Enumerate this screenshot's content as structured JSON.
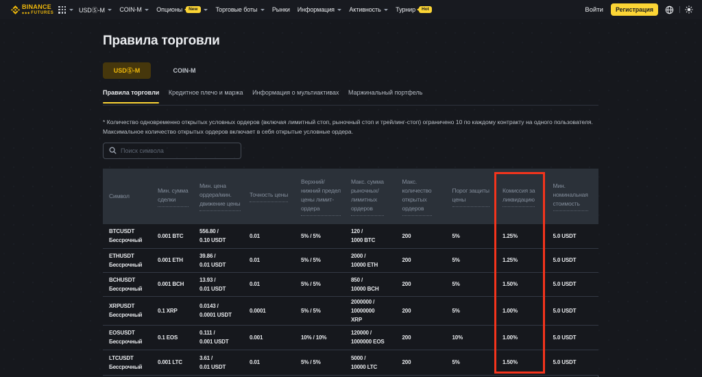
{
  "brand": {
    "name_top": "BINANCE",
    "name_bottom": "FUTURES"
  },
  "topnav": {
    "items": [
      {
        "label": "USDⓈ-M"
      },
      {
        "label": "COIN-M"
      },
      {
        "label": "Опционы",
        "badge": "New"
      },
      {
        "label": "Торговые боты"
      },
      {
        "label": "Рынки"
      },
      {
        "label": "Информация"
      },
      {
        "label": "Активность"
      },
      {
        "label": "Турнир",
        "badge": "Hot"
      }
    ],
    "login_label": "Войти",
    "register_label": "Регистрация"
  },
  "page": {
    "title": "Правила торговли",
    "market_tabs": [
      {
        "label": "USDⓈ-M",
        "active": true
      },
      {
        "label": "COIN-M",
        "active": false
      }
    ],
    "section_tabs": [
      {
        "label": "Правила торговли",
        "active": true
      },
      {
        "label": "Кредитное плечо и маржа",
        "active": false
      },
      {
        "label": "Информация о мультиактивах",
        "active": false
      },
      {
        "label": "Маржинальный портфель",
        "active": false
      }
    ],
    "note": "* Количество одновременно открытых условных ордеров (включая лимитный стоп, рыночный стоп и трейлинг-стоп) ограничено 10 по каждому контракту на одного пользователя.\nМаксимальное количество открытых ордеров включает в себя открытые условные ордера.",
    "search_placeholder": "Поиск символа"
  },
  "table": {
    "columns": [
      {
        "label": "Символ",
        "tooltip": false
      },
      {
        "label": "Мин. сумма\nсделки",
        "tooltip": true
      },
      {
        "label": "Мин. цена\nордера/мин.\nдвижение цены",
        "tooltip": true
      },
      {
        "label": "Точность цены",
        "tooltip": true
      },
      {
        "label": "Верхний/\nнижний предел\nцены лимит-\nордера",
        "tooltip": true
      },
      {
        "label": "Макс. сумма\nрыночных/\nлимитных\nордеров",
        "tooltip": true
      },
      {
        "label": "Макс.\nколичество\nоткрытых\nордеров",
        "tooltip": true
      },
      {
        "label": "Порог защиты\nцены",
        "tooltip": true
      },
      {
        "label": "Комиссия за\nликвидацию",
        "tooltip": true
      },
      {
        "label": "Мин.\nноминальная\nстоимость",
        "tooltip": true
      }
    ],
    "rows": [
      {
        "cells": [
          "BTCUSDT\nБессрочный",
          "0.001 BTC",
          "556.80 /\n0.10 USDT",
          "0.01",
          "5% / 5%",
          "120 /\n1000 BTC",
          "200",
          "5%",
          "1.25%",
          "5.0 USDT"
        ]
      },
      {
        "cells": [
          "ETHUSDT\nБессрочный",
          "0.001 ETH",
          "39.86 /\n0.01 USDT",
          "0.01",
          "5% / 5%",
          "2000 /\n10000 ETH",
          "200",
          "5%",
          "1.25%",
          "5.0 USDT"
        ]
      },
      {
        "cells": [
          "BCHUSDT\nБессрочный",
          "0.001 BCH",
          "13.93 /\n0.01 USDT",
          "0.01",
          "5% / 5%",
          "850 /\n10000 BCH",
          "200",
          "5%",
          "1.50%",
          "5.0 USDT"
        ]
      },
      {
        "cells": [
          "XRPUSDT\nБессрочный",
          "0.1 XRP",
          "0.0143 /\n0.0001 USDT",
          "0.0001",
          "5% / 5%",
          "2000000 /\n10000000\nXRP",
          "200",
          "5%",
          "1.00%",
          "5.0 USDT"
        ]
      },
      {
        "cells": [
          "EOSUSDT\nБессрочный",
          "0.1 EOS",
          "0.111 /\n0.001 USDT",
          "0.001",
          "10% / 10%",
          "120000 /\n1000000 EOS",
          "200",
          "10%",
          "1.00%",
          "5.0 USDT"
        ]
      },
      {
        "cells": [
          "LTCUSDT\nБессрочный",
          "0.001 LTC",
          "3.61 /\n0.01 USDT",
          "0.01",
          "5% / 5%",
          "5000 /\n10000 LTC",
          "200",
          "5%",
          "1.50%",
          "5.0 USDT"
        ]
      }
    ]
  },
  "highlight": {
    "color": "#F5341C",
    "column": "Комиссия за ликвидацию"
  },
  "colors": {
    "page_bg": "#16181D",
    "brand_yellow": "#F0B90B",
    "button_yellow": "#FCD535",
    "text_primary": "#EAECEF",
    "text_secondary": "#848E9C",
    "table_header_bg": "#2B3139"
  }
}
